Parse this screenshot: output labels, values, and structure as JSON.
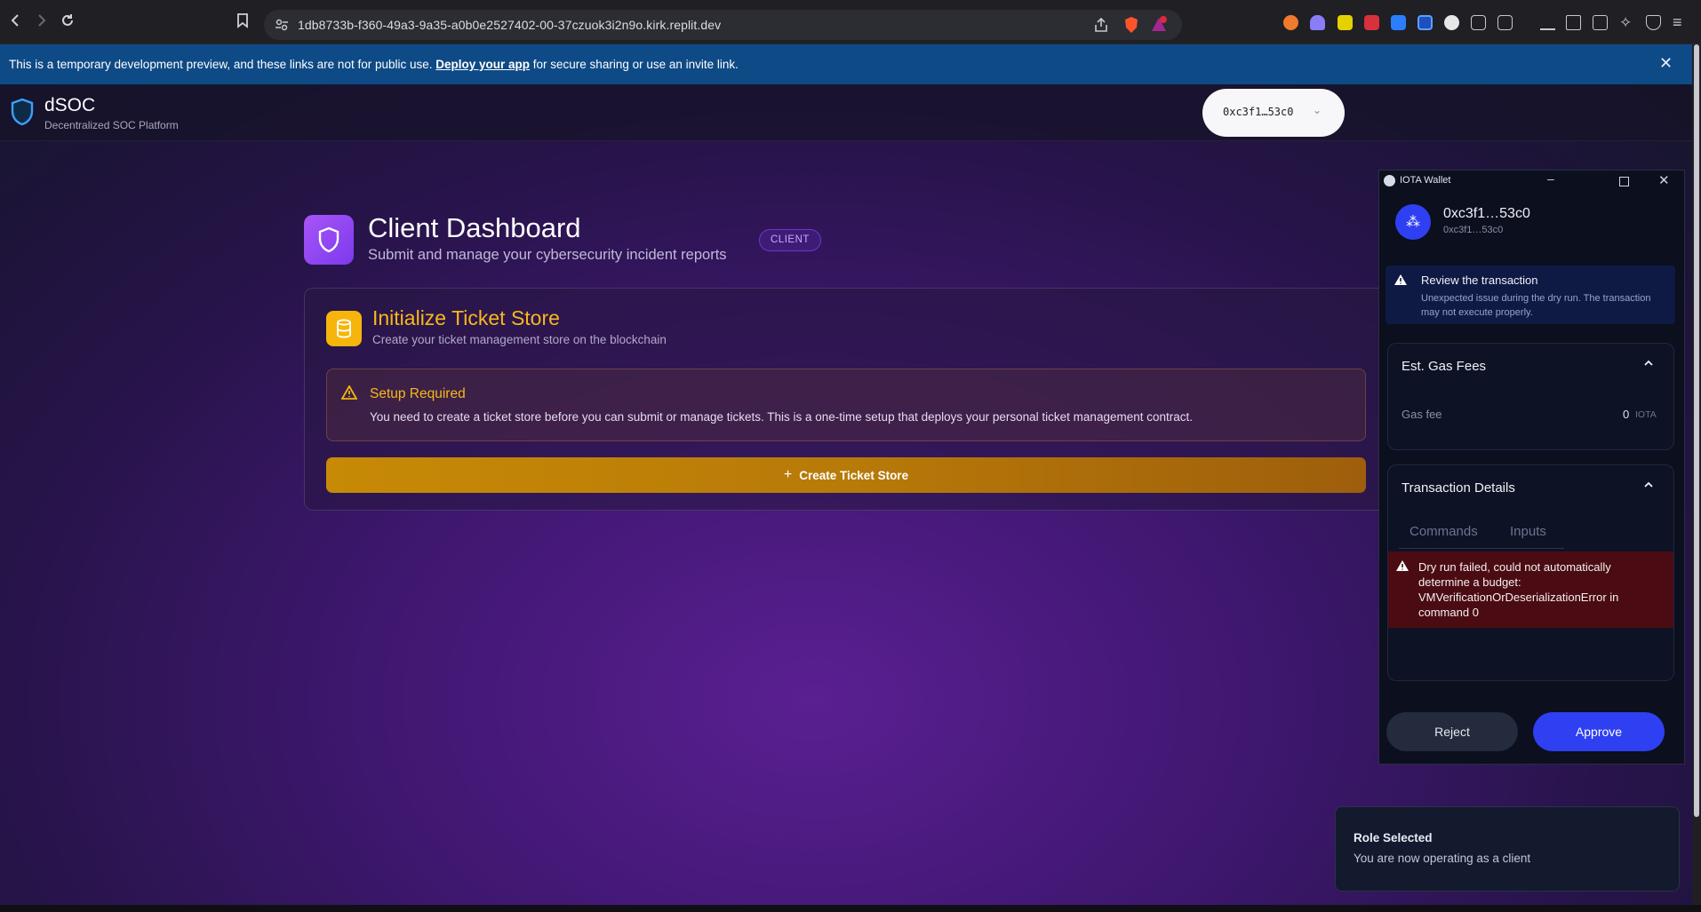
{
  "browser": {
    "url": "1db8733b-f360-49a3-9a35-a0b0e2527402-00-37czuok3i2n9o.kirk.replit.dev"
  },
  "banner": {
    "text_before": "This is a temporary development preview, and these links are not for public use.",
    "link": "Deploy your app",
    "text_after": " for secure sharing or use an invite link."
  },
  "app": {
    "name": "dSOC",
    "tagline": "Decentralized SOC Platform",
    "wallet_button": "0xc3f1…53c0"
  },
  "dashboard": {
    "title": "Client Dashboard",
    "subtitle": "Submit and manage your cybersecurity incident reports",
    "role_badge": "CLIENT"
  },
  "init_card": {
    "title": "Initialize Ticket Store",
    "subtitle": "Create your ticket management store on the blockchain",
    "alert_title": "Setup Required",
    "alert_text": "You need to create a ticket store before you can submit or manage tickets. This is a one-time setup that deploys your personal ticket management contract.",
    "button": "Create Ticket Store"
  },
  "wallet_popup": {
    "window_title": "IOTA Wallet",
    "account_name": "0xc3f1…53c0",
    "account_address": "0xc3f1…53c0",
    "review_title": "Review the transaction",
    "review_text": "Unexpected issue during the dry run. The transaction may not execute properly.",
    "gas_title": "Est. Gas Fees",
    "gas_label": "Gas fee",
    "gas_value": "0",
    "gas_unit": "IOTA",
    "details_title": "Transaction Details",
    "tab_commands": "Commands",
    "tab_inputs": "Inputs",
    "error_text": "Dry run failed, could not automatically determine a budget: VMVerificationOrDeserializationError in command 0",
    "reject": "Reject",
    "approve": "Approve"
  },
  "toast": {
    "title": "Role Selected",
    "text": "You are now operating as a client"
  },
  "colors": {
    "accent_purple": "#7c3aed",
    "gold": "#f5b50b",
    "approve_blue": "#2f3ff2",
    "error_red": "#4a0c12",
    "banner_blue": "#0e4a86"
  }
}
